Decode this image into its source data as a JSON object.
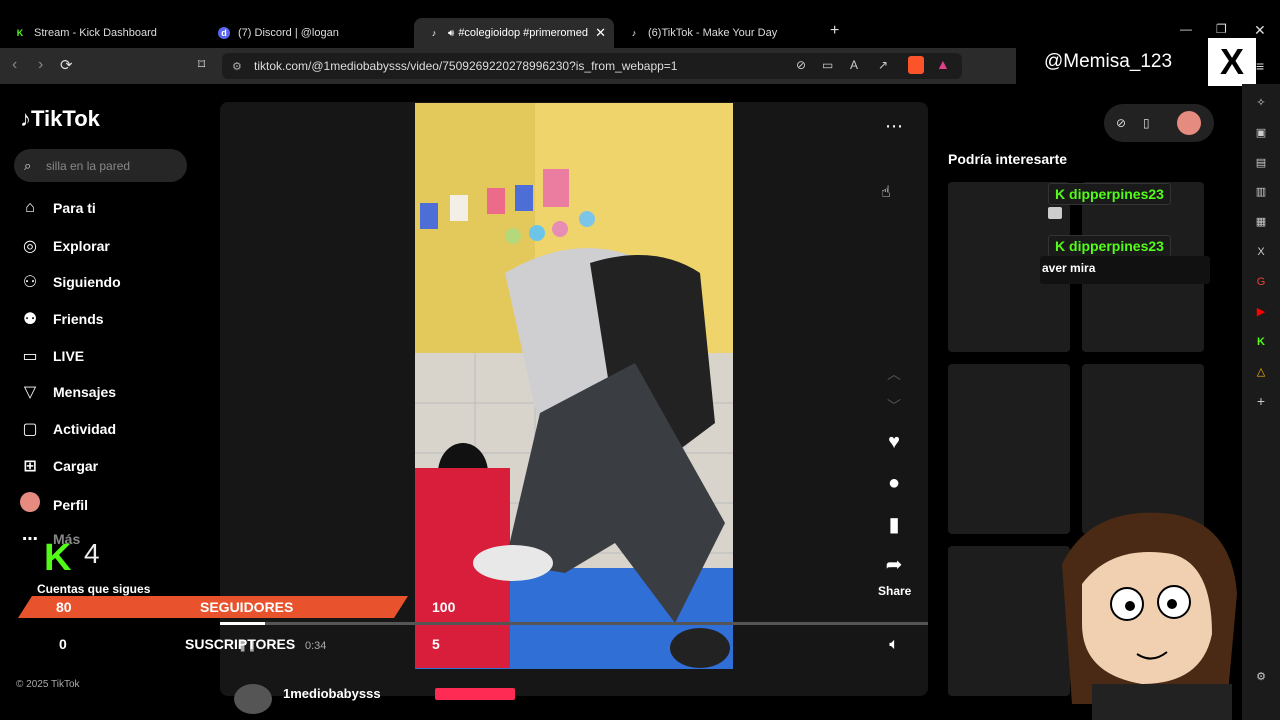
{
  "browser": {
    "tabs": [
      {
        "title": "Stream - Kick Dashboard",
        "favicon": "kick-icon",
        "color": "#53fc18"
      },
      {
        "title": "(7) Discord | @logan",
        "favicon": "discord-icon",
        "color": "#5865f2"
      },
      {
        "title": "#colegioidop #primeromedio",
        "favicon": "tiktok-icon",
        "color": "#ffffff"
      },
      {
        "title": "(6)TikTok - Make Your Day",
        "favicon": "tiktok-icon",
        "color": "#ffffff"
      }
    ],
    "url": "tiktok.com/@1mediobabysss/video/7509269220278996230?is_from_webapp=1"
  },
  "overlay": {
    "x_handle": "@Memisa_123",
    "x_logo": "X",
    "kick_count": "4",
    "follows_label": "Cuentas que sigues",
    "followers": {
      "current": "80",
      "label": "SEGUIDORES",
      "goal": "100"
    },
    "subscribers": {
      "current": "0",
      "label": "SUSCRIPTORES",
      "goal": "5"
    }
  },
  "tiktok": {
    "logo": "TikTok",
    "search_placeholder": "silla en la pared",
    "nav": [
      {
        "label": "Para ti",
        "icon": "home-icon"
      },
      {
        "label": "Explorar",
        "icon": "compass-icon"
      },
      {
        "label": "Siguiendo",
        "icon": "following-icon"
      },
      {
        "label": "Friends",
        "icon": "friends-icon"
      },
      {
        "label": "LIVE",
        "icon": "live-icon"
      },
      {
        "label": "Mensajes",
        "icon": "messages-icon"
      },
      {
        "label": "Actividad",
        "icon": "activity-icon"
      },
      {
        "label": "Cargar",
        "icon": "upload-icon"
      },
      {
        "label": "Perfil",
        "icon": "avatar"
      },
      {
        "label": "Más",
        "icon": "more-icon"
      }
    ],
    "footer": "© 2025 TikTok",
    "video_time": "0:34",
    "author": "1mediobabysss",
    "share_label": "Share",
    "recommend_title": "Podría interesarte"
  },
  "chat": [
    {
      "user": "dipperpines23",
      "message": ""
    },
    {
      "user": "dipperpines23",
      "message": "aver mira"
    }
  ]
}
